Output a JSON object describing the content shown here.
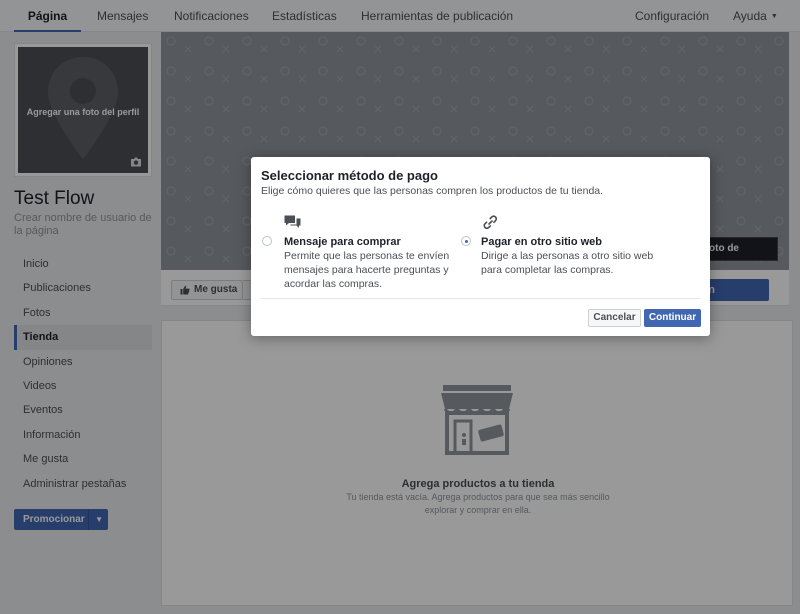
{
  "topnav": {
    "left_tabs": [
      {
        "label": "Página",
        "active": true
      },
      {
        "label": "Mensajes",
        "active": false
      },
      {
        "label": "Notificaciones",
        "active": false
      },
      {
        "label": "Estadísticas",
        "active": false
      },
      {
        "label": "Herramientas de publicación",
        "active": false
      }
    ],
    "settings": "Configuración",
    "help": "Ayuda"
  },
  "profile": {
    "photo_prompt": "Agregar una foto del perfil",
    "page_name": "Test Flow",
    "username_prompt": "Crear nombre de usuario de la página"
  },
  "sidebar": {
    "items": [
      {
        "label": "Inicio",
        "active": false
      },
      {
        "label": "Publicaciones",
        "active": false
      },
      {
        "label": "Fotos",
        "active": false
      },
      {
        "label": "Tienda",
        "active": true
      },
      {
        "label": "Opiniones",
        "active": false
      },
      {
        "label": "Videos",
        "active": false
      },
      {
        "label": "Eventos",
        "active": false
      },
      {
        "label": "Información",
        "active": false
      },
      {
        "label": "Me gusta",
        "active": false
      },
      {
        "label": "Administrar pestañas",
        "active": false
      }
    ],
    "promote_label": "Promocionar"
  },
  "cover": {
    "button_label": "oto de portada"
  },
  "actions": {
    "like_label": "Me gusta",
    "cta_label": "n"
  },
  "shop": {
    "title": "Agrega productos a tu tienda",
    "description": "Tu tienda está vacía. Agrega productos para que sea más sencillo explorar y comprar en ella."
  },
  "modal": {
    "title": "Seleccionar método de pago",
    "subtitle": "Elige cómo quieres que las personas compren los productos de tu tienda.",
    "options": [
      {
        "title": "Mensaje para comprar",
        "description": "Permite que las personas te envíen mensajes para hacerte preguntas y acordar las compras.",
        "icon": "message-bubbles-icon",
        "selected": false
      },
      {
        "title": "Pagar en otro sitio web",
        "description": "Dirige a las personas a otro sitio web para completar las compras.",
        "icon": "link-icon",
        "selected": true
      }
    ],
    "cancel_label": "Cancelar",
    "continue_label": "Continuar"
  },
  "colors": {
    "accent": "#4267b2",
    "overlay": "rgba(0,0,0,0.4)"
  }
}
